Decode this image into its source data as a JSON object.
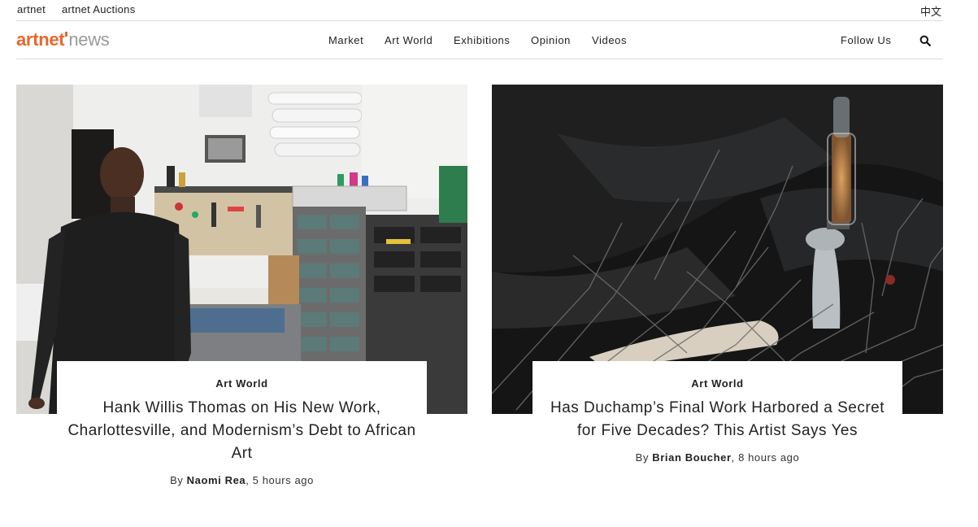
{
  "utility": {
    "links": [
      "artnet",
      "artnet Auctions"
    ],
    "language": "中文"
  },
  "logo": {
    "brand": "artnet",
    "sub": "news"
  },
  "nav": {
    "items": [
      "Market",
      "Art World",
      "Exhibitions",
      "Opinion",
      "Videos"
    ],
    "follow": "Follow Us",
    "search_icon": "search-icon"
  },
  "articles": [
    {
      "category": "Art World",
      "title": "Hank Willis Thomas on His New Work, Charlottesville, and Modernism’s Debt to African Art",
      "by": "By ",
      "author": "Naomi Rea",
      "time": ", 5 hours ago"
    },
    {
      "category": "Art World",
      "title": "Has Duchamp’s Final Work Harbored a Secret for Five Decades? This Artist Says Yes",
      "by": "By ",
      "author": "Brian Boucher",
      "time": ", 8 hours ago"
    }
  ],
  "colors": {
    "brand": "#e8672b",
    "text": "#222222",
    "divider": "#dcdcdc"
  }
}
